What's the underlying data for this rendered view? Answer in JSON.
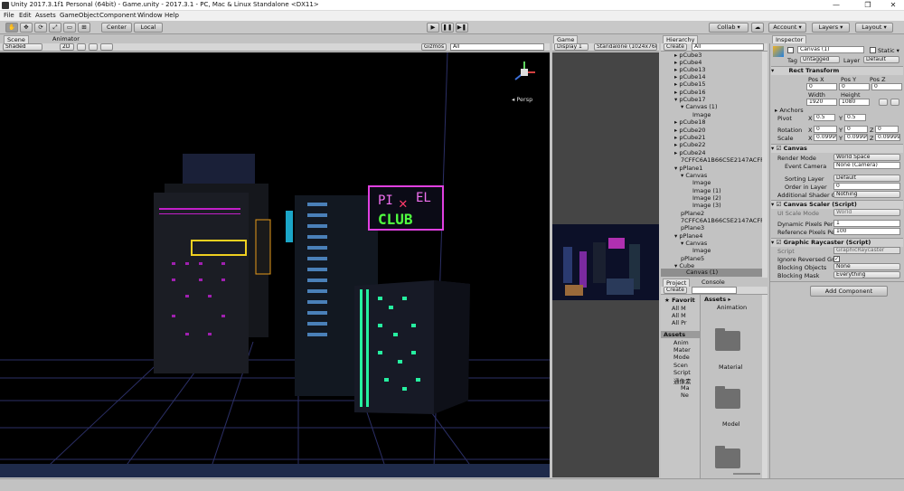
{
  "window": {
    "title": "Unity 2017.3.1f1 Personal (64bit) - Game.unity - 2017.3.1 - PC, Mac & Linux Standalone <DX11>",
    "minimize": "—",
    "maximize": "❐",
    "close": "✕"
  },
  "menu": [
    "File",
    "Edit",
    "Assets",
    "GameObject",
    "Component",
    "Window",
    "Help"
  ],
  "toolbar": {
    "tools": [
      "✋",
      "✥",
      "⟳",
      "⤢",
      "▭",
      "⊞"
    ],
    "pivot": "Center",
    "space": "Local",
    "play": "▶",
    "pause": "❚❚",
    "step": "▶❚",
    "collab": "Collab ▾",
    "cloud": "☁",
    "account": "Account ▾",
    "layers": "Layers ▾",
    "layout": "Layout ▾"
  },
  "scene": {
    "tab_scene": "Scene",
    "tab_animator": "Animator",
    "shading": "Shaded",
    "mode2d": "2D",
    "gizmos": "Gizmos ▾",
    "search": "All",
    "persp": "◂ Persp",
    "sign_top": "PI",
    "sign_x": "✕",
    "sign_el": "EL",
    "sign_club": "CLUB"
  },
  "game": {
    "tab": "Game",
    "display": "Display 1",
    "resolution": "Standalone (1024x768)"
  },
  "hierarchy": {
    "tab": "Hierarchy",
    "create": "Create ▾",
    "search": "All",
    "items": [
      {
        "label": "pCube3",
        "arrow": "▸"
      },
      {
        "label": "pCube4",
        "arrow": "▸"
      },
      {
        "label": "pCube13",
        "arrow": "▸"
      },
      {
        "label": "pCube14",
        "arrow": "▸"
      },
      {
        "label": "pCube15",
        "arrow": "▸"
      },
      {
        "label": "pCube16",
        "arrow": "▸"
      },
      {
        "label": "pCube17",
        "arrow": "▾"
      },
      {
        "label": "Canvas (1)",
        "arrow": "▾"
      },
      {
        "label": "Image",
        "arrow": ""
      },
      {
        "label": "pCube18",
        "arrow": "▸"
      },
      {
        "label": "pCube20",
        "arrow": "▸"
      },
      {
        "label": "pCube21",
        "arrow": "▸"
      },
      {
        "label": "pCube22",
        "arrow": "▸"
      },
      {
        "label": "pCube24",
        "arrow": "▸"
      },
      {
        "label": "7CFFC6A1B66C5E2147ACFF10",
        "arrow": ""
      },
      {
        "label": "pPlane1",
        "arrow": "▾"
      },
      {
        "label": "Canvas",
        "arrow": "▾"
      },
      {
        "label": "Image",
        "arrow": ""
      },
      {
        "label": "Image (1)",
        "arrow": ""
      },
      {
        "label": "Image (2)",
        "arrow": ""
      },
      {
        "label": "Image (3)",
        "arrow": ""
      },
      {
        "label": "pPlane2",
        "arrow": ""
      },
      {
        "label": "7CFFC6A1B66C5E2147ACFF10",
        "arrow": ""
      },
      {
        "label": "pPlane3",
        "arrow": ""
      },
      {
        "label": "pPlane4",
        "arrow": "▾"
      },
      {
        "label": "Canvas",
        "arrow": "▾"
      },
      {
        "label": "Image",
        "arrow": ""
      },
      {
        "label": "pPlane5",
        "arrow": ""
      },
      {
        "label": "Cube",
        "arrow": "▾"
      },
      {
        "label": "Canvas (1)",
        "arrow": ""
      }
    ]
  },
  "project": {
    "tab_project": "Project",
    "tab_console": "Console",
    "create": "Create ▾",
    "favorites": "Favorit",
    "tree": [
      "All M",
      "All M",
      "All Pr"
    ],
    "assets_root": "Assets",
    "folders": [
      "Anim",
      "Mater",
      "Mode",
      "Scen",
      "Script",
      "通像素",
      "Ma",
      "Ne"
    ],
    "assets_label": "Assets ▸",
    "grid": [
      "Animation",
      "Material",
      "Model",
      ""
    ]
  },
  "inspector": {
    "tab": "Inspector",
    "object_name": "Canvas (1)",
    "static": "Static ▾",
    "tag_label": "Tag",
    "tag": "Untagged",
    "layer_label": "Layer",
    "layer": "Default",
    "rect": {
      "title": "Rect Transform",
      "pos_x_label": "Pos X",
      "pos_y_label": "Pos Y",
      "pos_z_label": "Pos Z",
      "pos_x": "0",
      "pos_y": "0",
      "pos_z": "0",
      "width_label": "Width",
      "height_label": "Height",
      "width": "1920",
      "height": "1080",
      "anchors": "▸ Anchors",
      "pivot_label": "Pivot",
      "pivot_x": "0.5",
      "pivot_y": "0.5",
      "rotation_label": "Rotation",
      "rot_x": "0",
      "rot_y": "0",
      "rot_z": "0",
      "scale_label": "Scale",
      "scale_x": "0.09999",
      "scale_y": "0.09999",
      "scale_z": "0.09999"
    },
    "canvas": {
      "title": "Canvas",
      "render_mode_label": "Render Mode",
      "render_mode": "World Space",
      "event_camera_label": "Event Camera",
      "event_camera": "None (Camera)",
      "sorting_layer_label": "Sorting Layer",
      "sorting_layer": "Default",
      "order_label": "Order in Layer",
      "order": "0",
      "shader_label": "Additional Shader Cl",
      "shader": "Nothing"
    },
    "scaler": {
      "title": "Canvas Scaler (Script)",
      "ui_scale_label": "UI Scale Mode",
      "ui_scale": "World",
      "dynamic_label": "Dynamic Pixels Per U",
      "dynamic": "1",
      "reference_label": "Reference Pixels Per",
      "reference": "100"
    },
    "raycaster": {
      "title": "Graphic Raycaster (Script)",
      "script_label": "Script",
      "script": "GraphicRaycaster",
      "ignore_label": "Ignore Reversed Gra",
      "blocking_objects_label": "Blocking Objects",
      "blocking_objects": "None",
      "blocking_mask_label": "Blocking Mask",
      "blocking_mask": "Everything"
    },
    "add_component": "Add Component"
  }
}
